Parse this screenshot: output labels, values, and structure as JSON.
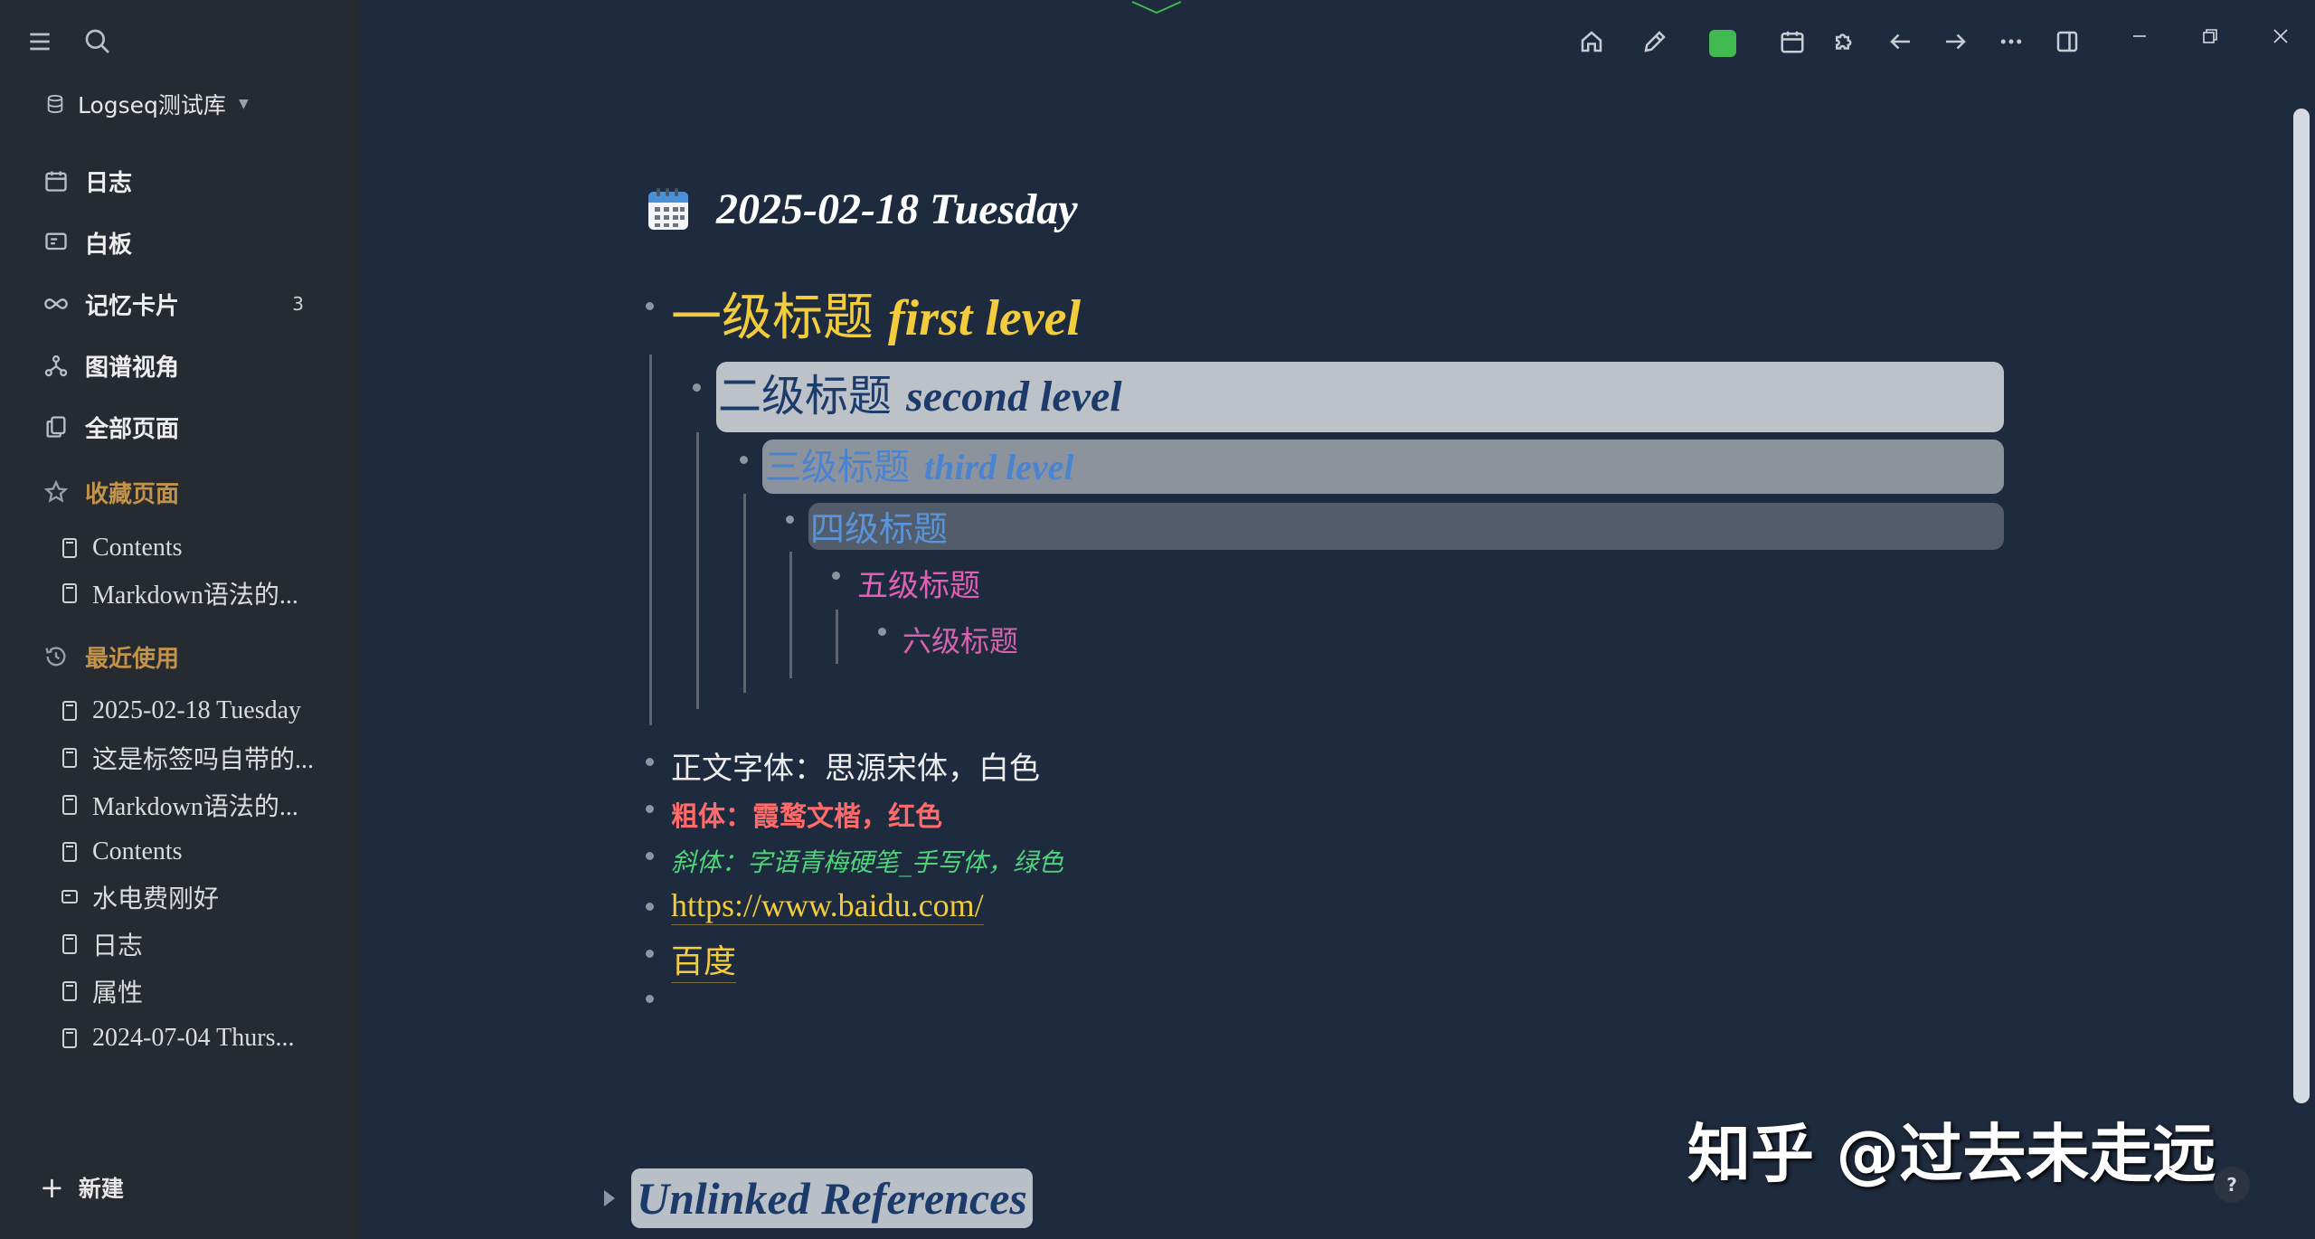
{
  "sidebar": {
    "graph_name": "Logseq测试库",
    "nav": [
      {
        "label": "日志",
        "icon": "calendar-icon"
      },
      {
        "label": "白板",
        "icon": "whiteboard-icon"
      },
      {
        "label": "记忆卡片",
        "icon": "infinity-icon",
        "count": "3"
      },
      {
        "label": "图谱视角",
        "icon": "graph-icon"
      },
      {
        "label": "全部页面",
        "icon": "pages-icon"
      }
    ],
    "favorites_title": "收藏页面",
    "favorites": [
      "Contents",
      "Markdown语法的..."
    ],
    "recent_title": "最近使用",
    "recent": [
      "2025-02-18 Tuesday",
      "这是标签吗自带的...",
      "Markdown语法的...",
      "Contents",
      "水电费刚好",
      "日志",
      "属性",
      "2024-07-04 Thurs..."
    ],
    "new_label": "新建"
  },
  "page": {
    "title": "2025-02-18 Tuesday",
    "h1": {
      "zh": "一级标题",
      "en": "first level"
    },
    "h2": {
      "zh": "二级标题",
      "en": "second level"
    },
    "h3": {
      "zh": "三级标题",
      "en": "third level"
    },
    "h4": {
      "zh": "四级标题"
    },
    "h5": {
      "zh": "五级标题"
    },
    "h6": {
      "zh": "六级标题"
    },
    "blocks": {
      "plain": "正文字体：思源宋体，白色",
      "bold": "粗体：霞鹜文楷，红色",
      "italic": "斜体：字语青梅硬笔_手写体，绿色",
      "link": "https://www.baidu.com/",
      "link_text": "百度"
    },
    "unlinked_references": "Unlinked References"
  },
  "watermark": "知乎 @过去未走远",
  "help_label": "?",
  "colors": {
    "background": "#1e2a3d",
    "sidebar": "#262a31",
    "accent_yellow": "#f2cc3c",
    "favorites_orange": "#c3934a",
    "green_square": "#3fb950"
  }
}
